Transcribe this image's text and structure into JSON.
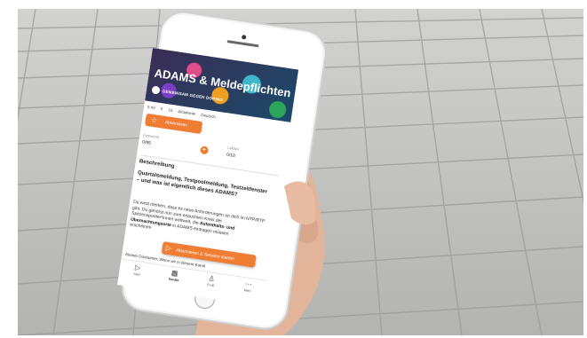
{
  "app": {
    "hero_title": "ADAMS & Meldepflichten",
    "hero_subtitle": "GEMEINSAM GEGEN DOPING",
    "meta": [
      "5 ml",
      "5",
      "15",
      "Akademie",
      "Deutsch"
    ],
    "subscribe_label": "Abonnieren",
    "progress": {
      "left_label": "Fortschritt",
      "left_value": "0/95",
      "right_label": "Lektion",
      "right_value": "0/10"
    },
    "description_title": "Beschreibung",
    "lead": "Quartalsmeldung, Testpoolmeldung, Testzeitfenster – und was ist eigentlich dieses ADAMS?",
    "body_1": "Du wirst merken, dass es neue Anforderungen an dich im NTP/RTP gibt. Du gehörst nun zum erlauchten Kreis der Spitzensportler*innen weltweit, die ",
    "body_bold_1": "Aufenthalts- und Übernachtungsorte",
    "body_2": " in ADAMS eintragen müssen",
    "body_3": "erscheinen",
    "cta_label": "Abonnieren & Session starten",
    "disclaimer": "Kleiner Disclaimer: Wenn wir in diesem Kanal",
    "tabs": [
      {
        "label": "Start",
        "icon": "play-icon"
      },
      {
        "label": "Kanäle",
        "icon": "grid-icon"
      },
      {
        "label": "Profil",
        "icon": "user-icon"
      },
      {
        "label": "Mehr",
        "icon": "more-icon"
      }
    ]
  },
  "colors": {
    "accent": "#f07d34"
  }
}
